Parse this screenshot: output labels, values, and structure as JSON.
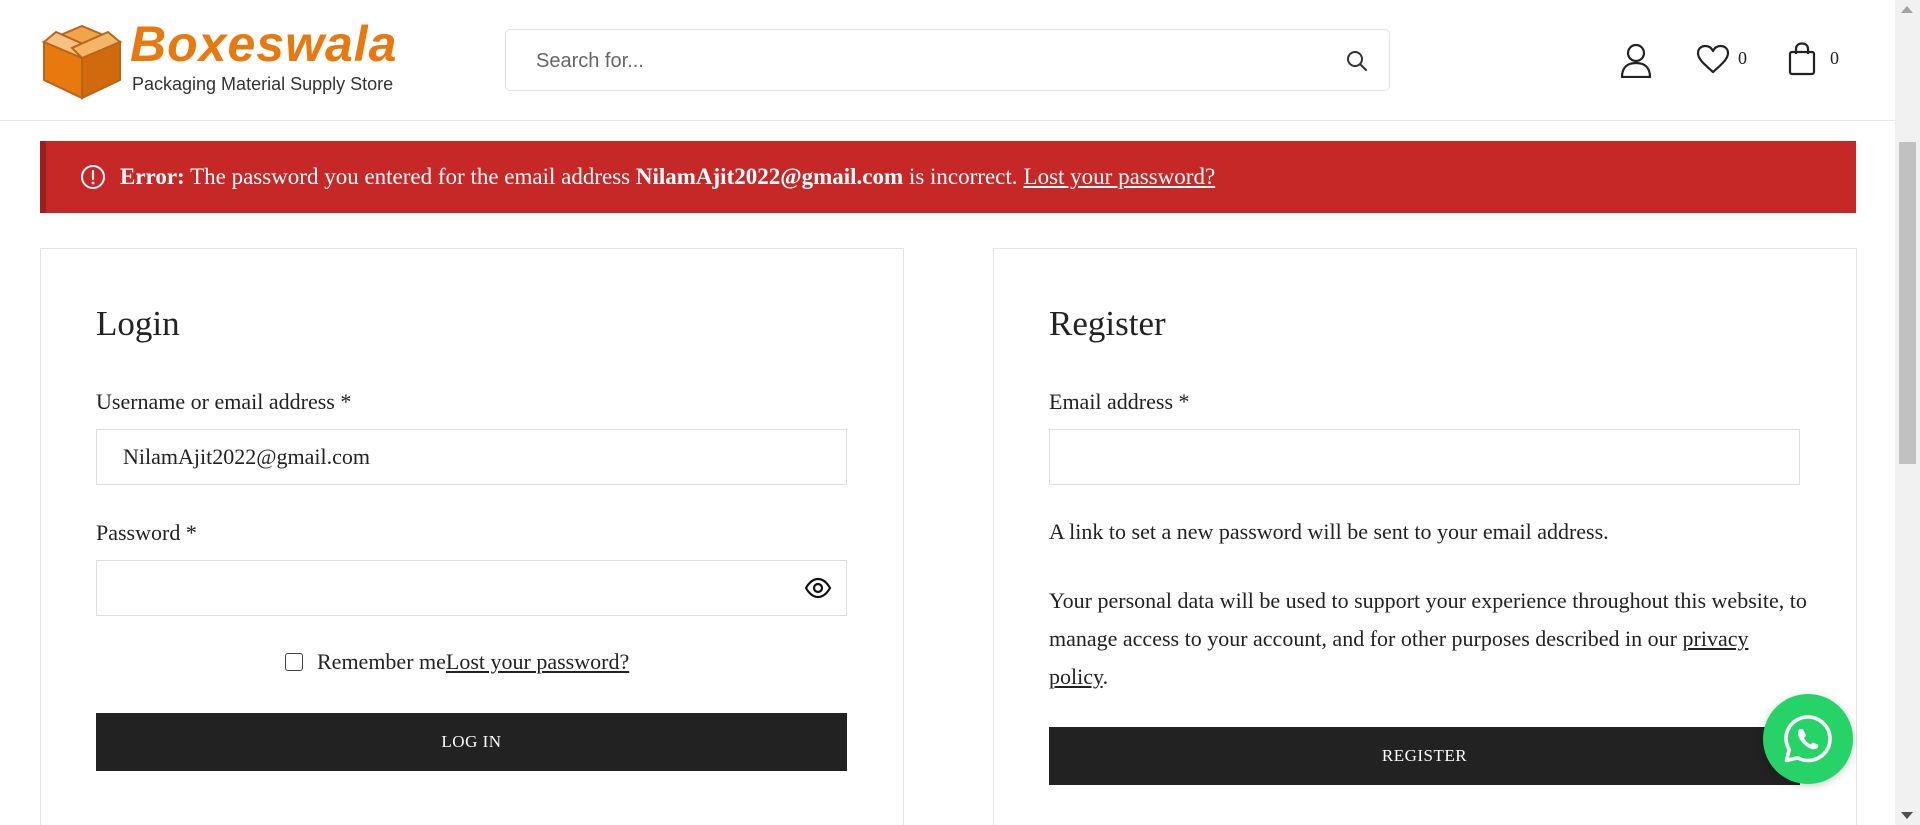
{
  "header": {
    "logo": {
      "name": "Boxeswala",
      "tagline": "Packaging Material Supply Store"
    },
    "search": {
      "placeholder": "Search for...",
      "value": ""
    },
    "icons": {
      "account": "user-icon",
      "wishlist": "heart-icon",
      "cart": "shopping-bag-icon",
      "search": "search-icon"
    },
    "wishlist_count": "0",
    "cart_count": "0"
  },
  "error_banner": {
    "label": "Error:",
    "message_before": "The password you entered for the email address",
    "email": "NilamAjit2022@gmail.com",
    "message_after": "is incorrect.",
    "link_text": "Lost your password?"
  },
  "login": {
    "title": "Login",
    "username_label": "Username or email address *",
    "username_value": "NilamAjit2022@gmail.com",
    "password_label": "Password *",
    "password_value": "",
    "remember_label": "Remember me",
    "lost_password_link": "Lost your password?",
    "button_label": "LOG IN"
  },
  "register": {
    "title": "Register",
    "email_label": "Email address *",
    "email_value": "",
    "info_text": "A link to set a new password will be sent to your email address.",
    "privacy_text_before": "Your personal data will be used to support your experience throughout this website, to manage access to your account, and for other purposes described in our",
    "privacy_link": "privacy policy",
    "privacy_text_after": ".",
    "button_label": "REGISTER"
  },
  "colors": {
    "brand_orange": "#e8790f",
    "error_red": "#c62828",
    "button_dark": "#222222",
    "whatsapp_green": "#25d366"
  }
}
